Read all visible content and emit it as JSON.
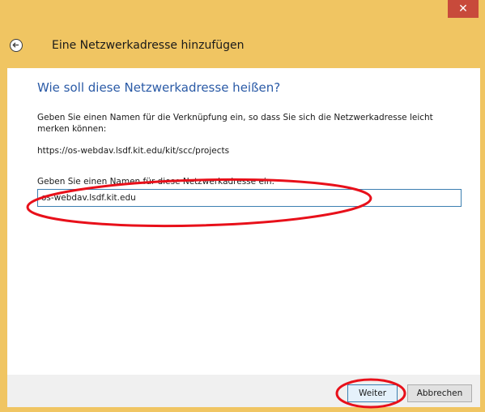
{
  "window": {
    "close_glyph": "✕"
  },
  "header": {
    "title": "Eine Netzwerkadresse hinzufügen"
  },
  "content": {
    "heading": "Wie soll diese Netzwerkadresse heißen?",
    "description": "Geben Sie einen Namen für die Verknüpfung ein, so dass Sie sich die Netzwerkadresse leicht merken können:",
    "url": "https://os-webdav.lsdf.kit.edu/kit/scc/projects",
    "field_label": "Geben Sie einen Namen für diese Netzwerkadresse ein:",
    "name_value": "os-webdav.lsdf.kit.edu"
  },
  "footer": {
    "next_label": "Weiter",
    "cancel_label": "Abbrechen"
  },
  "colors": {
    "title_bar": "#f0c562",
    "close_button": "#c84a3b",
    "heading": "#2a5aa6",
    "annotation": "#e8101a"
  }
}
